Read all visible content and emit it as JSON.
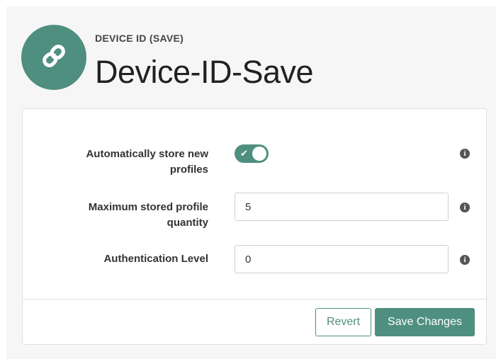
{
  "header": {
    "subtitle": "DEVICE ID (SAVE)",
    "title": "Device-ID-Save",
    "icon": "link-icon"
  },
  "form": {
    "fields": [
      {
        "label_line1": "Automatically store new",
        "label_line2": "profiles",
        "type": "toggle",
        "value": true,
        "info_icon": "info-icon"
      },
      {
        "label_line1": "Maximum stored profile",
        "label_line2": "quantity",
        "type": "text",
        "value": "5",
        "info_icon": "info-icon"
      },
      {
        "label_line1": "Authentication Level",
        "type": "text",
        "value": "0",
        "info_icon": "info-icon"
      }
    ]
  },
  "buttons": {
    "revert": "Revert",
    "save": "Save Changes"
  },
  "colors": {
    "accent": "#4f8f7f",
    "page_background": "#f6f6f6",
    "card_border": "#e1e1e1",
    "info_icon": "#555555"
  }
}
